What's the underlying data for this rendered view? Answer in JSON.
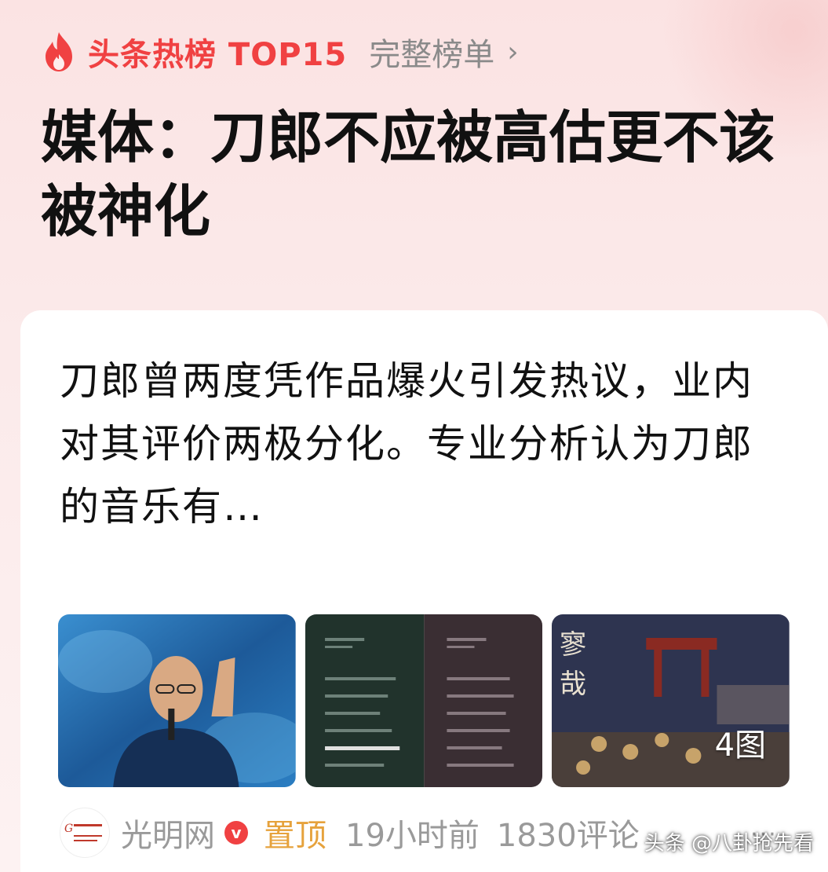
{
  "header": {
    "hot_title": "头条热榜 TOP15",
    "full_list_label": "完整榜单",
    "chevron": "›"
  },
  "headline": "媒体：刀郎不应被高估更不该被神化",
  "card": {
    "summary": "刀郎曾两度凭作品爆火引发热议，业内对其评价两极分化。专业分析认为刀郎的音乐有…",
    "image_count": "4图",
    "source_name": "光明网",
    "verified_mark": "v",
    "pinned": "置顶",
    "time": "19小时前",
    "comments": "1830评论",
    "more": "···"
  },
  "watermark": "头条 @八卦抢先看",
  "colors": {
    "accent_red": "#f04142",
    "pinned_orange": "#e6a23c",
    "muted_gray": "#9a9a9a"
  },
  "icons": [
    "flame-icon",
    "chevron-right-icon",
    "verified-icon",
    "more-icon"
  ]
}
